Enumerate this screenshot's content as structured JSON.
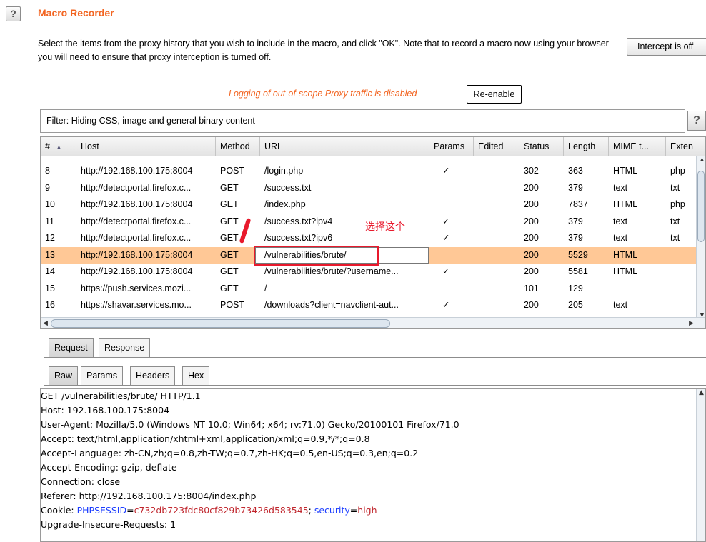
{
  "header": {
    "help_label": "?",
    "title": "Macro Recorder",
    "description": "Select the items from the proxy history that you wish to include in the macro, and click \"OK\". Note that to record a macro now using your browser you will need to ensure that proxy interception is turned off.",
    "intercept_label": "Intercept is off"
  },
  "logging": {
    "message": "Logging of out-of-scope Proxy traffic is disabled",
    "reenable_label": "Re-enable"
  },
  "filter": {
    "text": "Filter: Hiding CSS, image and general binary content",
    "help_label": "?"
  },
  "table": {
    "columns": [
      "#",
      "Host",
      "Method",
      "URL",
      "Params",
      "Edited",
      "Status",
      "Length",
      "MIME t...",
      "Exten"
    ],
    "sort_indicator": "▲",
    "rows": [
      {
        "num": "8",
        "host": "http://192.168.100.175:8004",
        "method": "POST",
        "url": "/login.php",
        "params": "✓",
        "edited": "",
        "status": "302",
        "length": "363",
        "mime": "HTML",
        "ext": "php"
      },
      {
        "num": "9",
        "host": "http://detectportal.firefox.c...",
        "method": "GET",
        "url": "/success.txt",
        "params": "",
        "edited": "",
        "status": "200",
        "length": "379",
        "mime": "text",
        "ext": "txt"
      },
      {
        "num": "10",
        "host": "http://192.168.100.175:8004",
        "method": "GET",
        "url": "/index.php",
        "params": "",
        "edited": "",
        "status": "200",
        "length": "7837",
        "mime": "HTML",
        "ext": "php"
      },
      {
        "num": "11",
        "host": "http://detectportal.firefox.c...",
        "method": "GET",
        "url": "/success.txt?ipv4",
        "params": "✓",
        "edited": "",
        "status": "200",
        "length": "379",
        "mime": "text",
        "ext": "txt"
      },
      {
        "num": "12",
        "host": "http://detectportal.firefox.c...",
        "method": "GET",
        "url": "/success.txt?ipv6",
        "params": "✓",
        "edited": "",
        "status": "200",
        "length": "379",
        "mime": "text",
        "ext": "txt"
      },
      {
        "num": "13",
        "host": "http://192.168.100.175:8004",
        "method": "GET",
        "url": "/vulnerabilities/brute/",
        "params": "",
        "edited": "",
        "status": "200",
        "length": "5529",
        "mime": "HTML",
        "ext": ""
      },
      {
        "num": "14",
        "host": "http://192.168.100.175:8004",
        "method": "GET",
        "url": "/vulnerabilities/brute/?username...",
        "params": "✓",
        "edited": "",
        "status": "200",
        "length": "5581",
        "mime": "HTML",
        "ext": ""
      },
      {
        "num": "15",
        "host": "https://push.services.mozi...",
        "method": "GET",
        "url": "/",
        "params": "",
        "edited": "",
        "status": "101",
        "length": "129",
        "mime": "",
        "ext": ""
      },
      {
        "num": "16",
        "host": "https://shavar.services.mo...",
        "method": "POST",
        "url": "/downloads?client=navclient-aut...",
        "params": "✓",
        "edited": "",
        "status": "200",
        "length": "205",
        "mime": "text",
        "ext": ""
      }
    ],
    "selected_row": 5
  },
  "annotation": {
    "text": "选择这个"
  },
  "tabs": {
    "outer": [
      "Request",
      "Response"
    ],
    "inner": [
      "Raw",
      "Params",
      "Headers",
      "Hex"
    ]
  },
  "request": {
    "lines": [
      "GET /vulnerabilities/brute/ HTTP/1.1",
      "Host: 192.168.100.175:8004",
      "User-Agent: Mozilla/5.0 (Windows NT 10.0; Win64; x64; rv:71.0) Gecko/20100101 Firefox/71.0",
      "Accept: text/html,application/xhtml+xml,application/xml;q=0.9,*/*;q=0.8",
      "Accept-Language: zh-CN,zh;q=0.8,zh-TW;q=0.7,zh-HK;q=0.5,en-US;q=0.3,en;q=0.2",
      "Accept-Encoding: gzip, deflate",
      "Connection: close",
      "Referer: http://192.168.100.175:8004/index.php"
    ],
    "cookie": {
      "prefix": "Cookie: ",
      "name1": "PHPSESSID",
      "eq1": "=",
      "val1": "c732db723fdc80cf829b73426d583545",
      "sep": "; ",
      "name2": "security",
      "eq2": "=",
      "val2": "high"
    },
    "last_line": "Upgrade-Insecure-Requests: 1"
  },
  "colors": {
    "accent": "#f26522",
    "selected_row": "#ffc896",
    "annotation": "#e8192c",
    "cookie_name": "#1a3cff",
    "cookie_value": "#c0262d"
  }
}
